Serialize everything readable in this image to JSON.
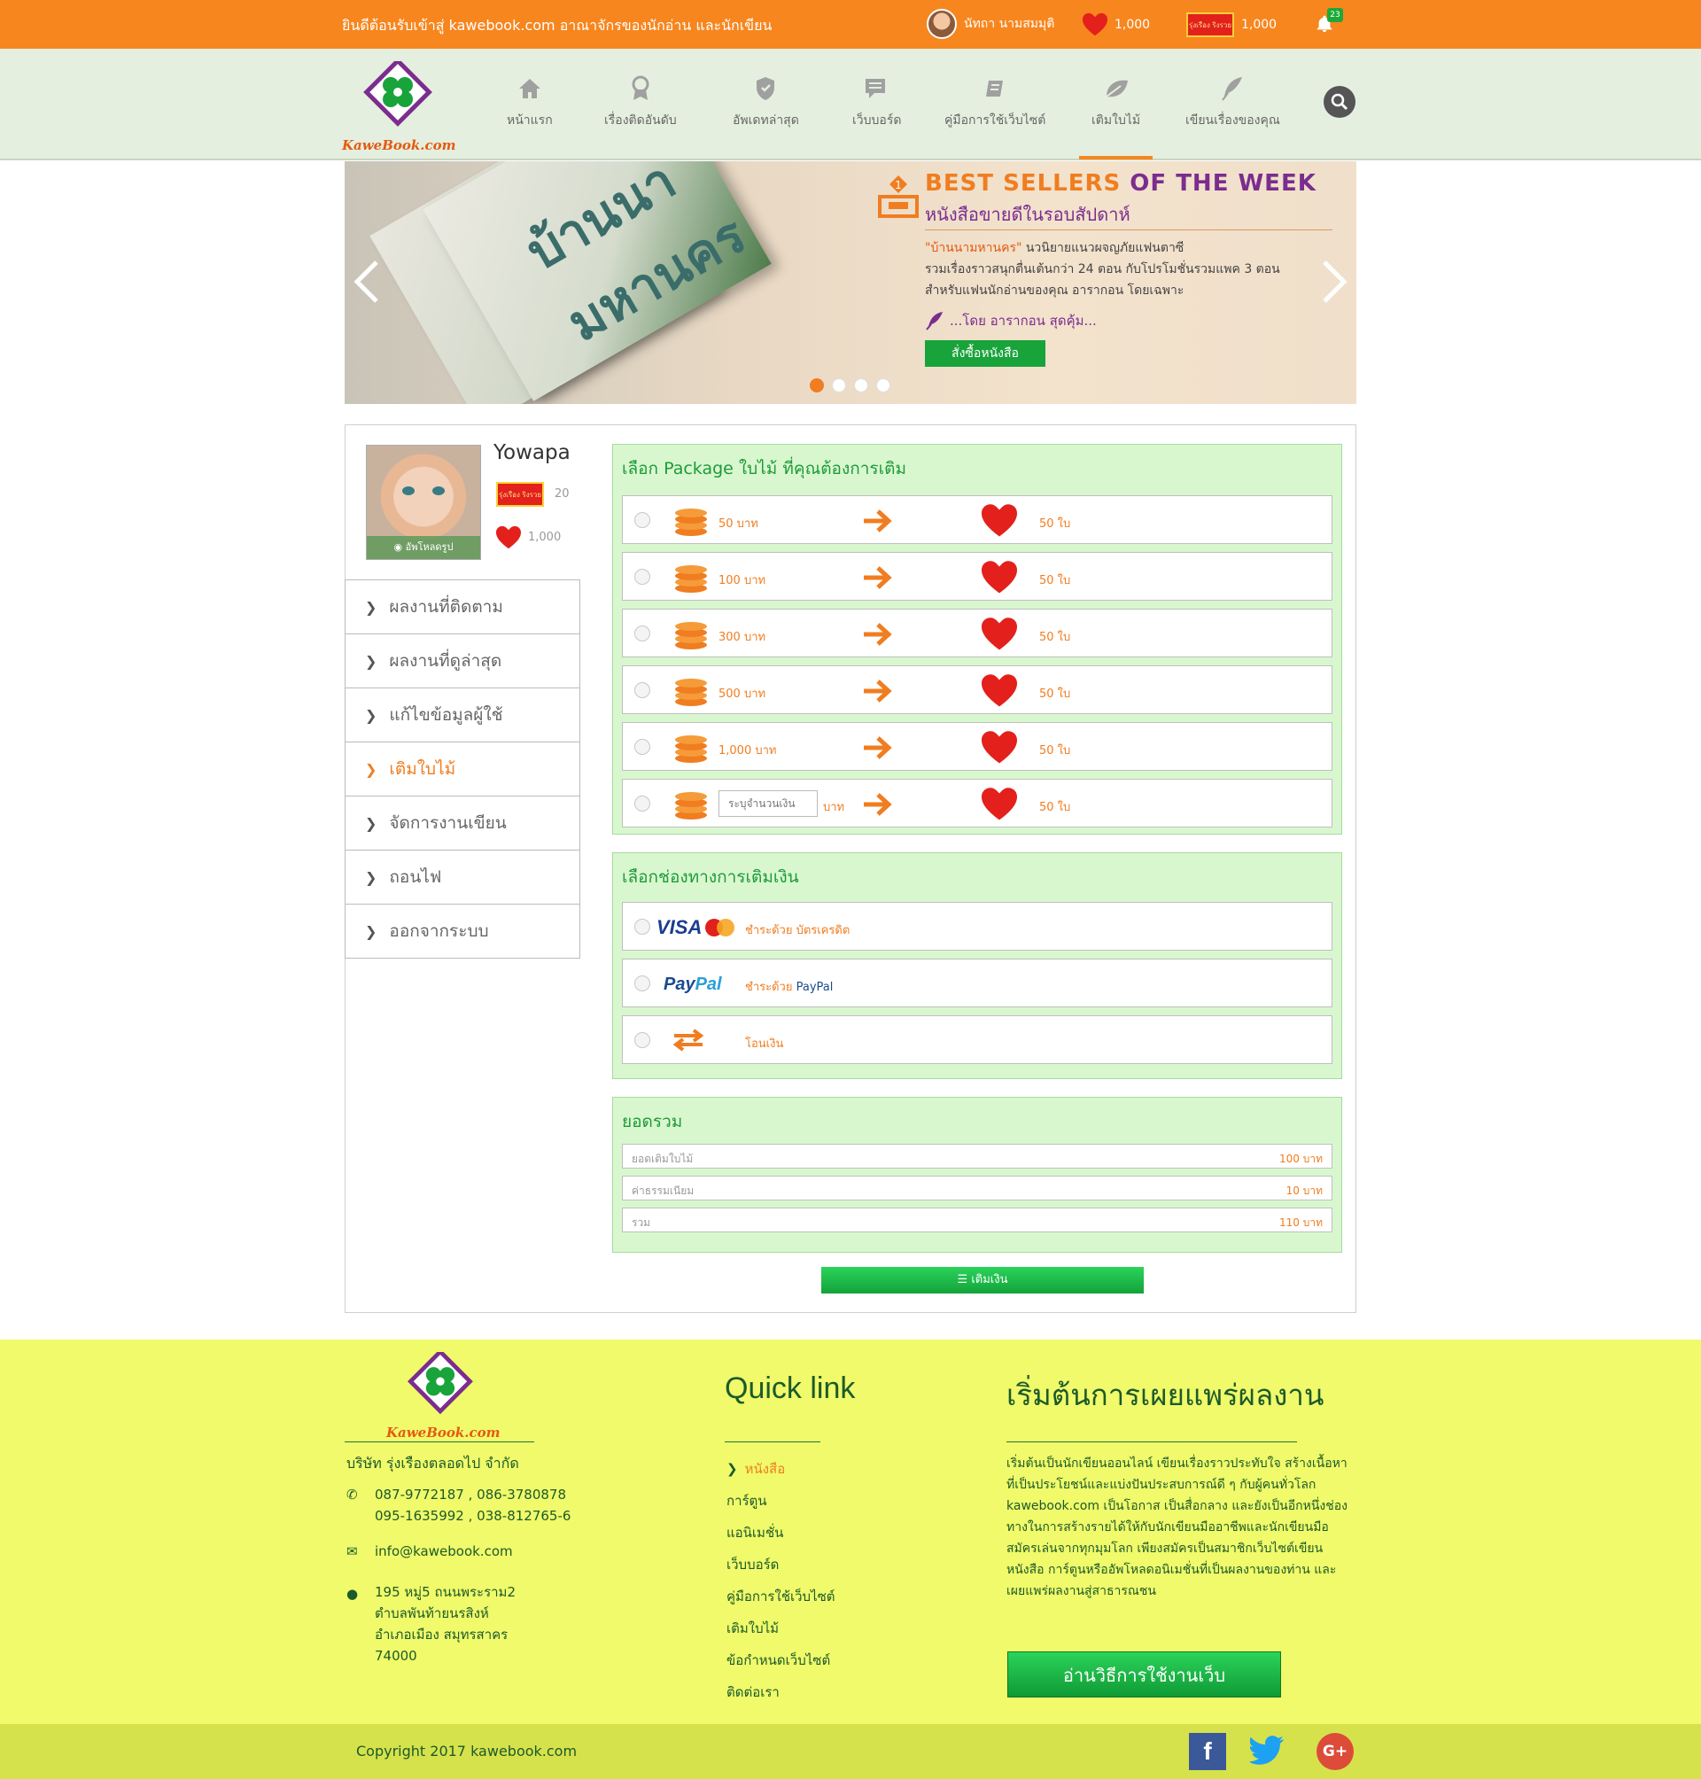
{
  "topbar": {
    "welcome": "ยินดีต้อนรับเข้าสู่ kawebook.com อาณาจักรของนักอ่าน และนักเขียน",
    "user_name": "นัทถา นามสมมุติ",
    "hearts": "1,000",
    "coupon_label": "รุ่งเรือง ริงรวย",
    "coins": "1,000",
    "notifications": "23"
  },
  "logo": {
    "text": "KaweBook.com"
  },
  "nav": {
    "items": [
      {
        "label": "หน้าแรก",
        "icon": "home-icon"
      },
      {
        "label": "เรื่องติดอันดับ",
        "icon": "award-icon"
      },
      {
        "label": "อัพเดทล่าสุด",
        "icon": "shield-icon"
      },
      {
        "label": "เว็บบอร์ด",
        "icon": "chat-icon"
      },
      {
        "label": "คู่มือการใช้เว็บไซต์",
        "icon": "book-icon"
      },
      {
        "label": "เติมใบไม้",
        "icon": "leaf-icon"
      },
      {
        "label": "เขียนเรื่องของคุณ",
        "icon": "quill-icon"
      }
    ],
    "active": "เติมใบไม้"
  },
  "banner": {
    "book_title": "บ้านนามหานคร",
    "title_part1": "BEST SELLERS",
    "title_part2": "OF THE WEEK",
    "subtitle": "หนังสือขายดีในรอบสัปดาห์",
    "desc_highlight": "\"บ้านนามหานคร\"",
    "desc_line1": " นวนิยายแนวผจญภัยแฟนตาซี",
    "desc_line2": "รวมเรื่องราวสนุกตื่นเต้นกว่า 24 ตอน กับโปรโมชั่นรวมแพค 3 ตอน",
    "desc_line3": "สำหรับแฟนนักอ่านของคุณ อารากอน โดยเฉพาะ",
    "author": "...โดย อารากอน สุดคุ้ม...",
    "button": "สั่งซื้อหนังสือ",
    "active_slide": 1,
    "slides": 4
  },
  "profile": {
    "name": "Yowapa",
    "upload": "อัพโหลดรูป",
    "coupons": "20",
    "hearts": "1,000"
  },
  "side_menu": [
    {
      "label": "ผลงานที่ติดตาม",
      "active": false
    },
    {
      "label": "ผลงานที่ดูล่าสุด",
      "active": false
    },
    {
      "label": "แก้ไขข้อมูลผู้ใช้",
      "active": false
    },
    {
      "label": "เติมใบไม้",
      "active": true
    },
    {
      "label": "จัดการงานเขียน",
      "active": false
    },
    {
      "label": "ถอนไฟ",
      "active": false
    },
    {
      "label": "ออกจากระบบ",
      "active": false
    }
  ],
  "packages": {
    "title": "เลือก Package ใบไม้ ที่คุณต้องการเติม",
    "rows": [
      {
        "amount": "50 บาท",
        "leaves": "50 ใบ"
      },
      {
        "amount": "100 บาท",
        "leaves": "50 ใบ"
      },
      {
        "amount": "300 บาท",
        "leaves": "50 ใบ"
      },
      {
        "amount": "500 บาท",
        "leaves": "50 ใบ"
      },
      {
        "amount": "1,000 บาท",
        "leaves": "50 ใบ"
      }
    ],
    "custom_placeholder": "ระบุจำนวนเงิน",
    "custom_unit": "บาท",
    "custom_leaves": "50 ใบ"
  },
  "payment": {
    "title": "เลือกช่องทางการเติมเงิน",
    "methods": [
      {
        "logo": "VISA",
        "label": "ชำระด้วย บัตรเครดิต",
        "label_extra": ""
      },
      {
        "logo_a": "Pay",
        "logo_b": "Pal",
        "label": "ชำระด้วย ",
        "label_extra": "PayPal"
      },
      {
        "logo": "transfer-icon",
        "label": "โอนเงิน",
        "label_extra": ""
      }
    ]
  },
  "summary": {
    "title": "ยอดรวม",
    "rows": [
      {
        "label": "ยอดเติมใบไม้",
        "value": "100 บาท"
      },
      {
        "label": "ค่าธรรมเนียม",
        "value": "10 บาท"
      },
      {
        "label": "รวม",
        "value": "110 บาท"
      }
    ],
    "button": "เติมเงิน"
  },
  "footer": {
    "logo_text": "KaweBook.com",
    "company": "บริษัท รุ่งเรืองตลอดไป จำกัด",
    "phone1": "087-9772187 , 086-3780878",
    "phone2": "095-1635992 , 038-812765-6",
    "email": "info@kawebook.com",
    "address1": "195 หมู่5 ถนนพระราม2",
    "address2": "ตำบลพันท้ายนรสิงห์",
    "address3": "อำเภอเมือง สมุทรสาคร",
    "address4": "74000",
    "quick_link_title": "Quick link",
    "quick_links": [
      {
        "label": "หนังสือ",
        "active": true
      },
      {
        "label": "การ์ตูน",
        "active": false
      },
      {
        "label": "แอนิเมชั่น",
        "active": false
      },
      {
        "label": "เว็บบอร์ด",
        "active": false
      },
      {
        "label": "คู่มือการใช้เว็บไซต์",
        "active": false
      },
      {
        "label": "เติมใบไม้",
        "active": false
      },
      {
        "label": "ข้อกำหนดเว็บไซต์",
        "active": false
      },
      {
        "label": "ติดต่อเรา",
        "active": false
      }
    ],
    "publish_title": "เริ่มต้นการเผยแพร่ผลงาน",
    "publish_text": "เริ่มต้นเป็นนักเขียนออนไลน์ เขียนเรื่องราวประทับใจ สร้างเนื้อหาที่เป็นประโยชน์และแบ่งปันประสบการณ์ดี ๆ กับผู้คนทั่วโลก kawebook.com เป็นโอกาส เป็นสื่อกลาง และยังเป็นอีกหนึ่งช่องทางในการสร้างรายได้ให้กับนักเขียนมืออาชีพและนักเขียนมือสมัครเล่นจากทุกมุมโลก เพียงสมัครเป็นสมาชิกเว็บไซต์เขียนหนังสือ การ์ตูนหรืออัพโหลดอนิเมชั่นที่เป็นผลงานของท่าน และเผยแพร่ผลงานสู่สาธารณชน",
    "guide_button": "อ่านวิธีการใช้งานเว็บ",
    "copyright": "Copyright 2017 kawebook.com",
    "social": [
      "facebook-icon",
      "twitter-icon",
      "google-plus-icon"
    ],
    "social_gp": "G+"
  },
  "colors": {
    "orange": "#f7861e",
    "green": "#1d9b3a",
    "panel": "#d9f7cf",
    "footer": "#f0fa6a"
  }
}
